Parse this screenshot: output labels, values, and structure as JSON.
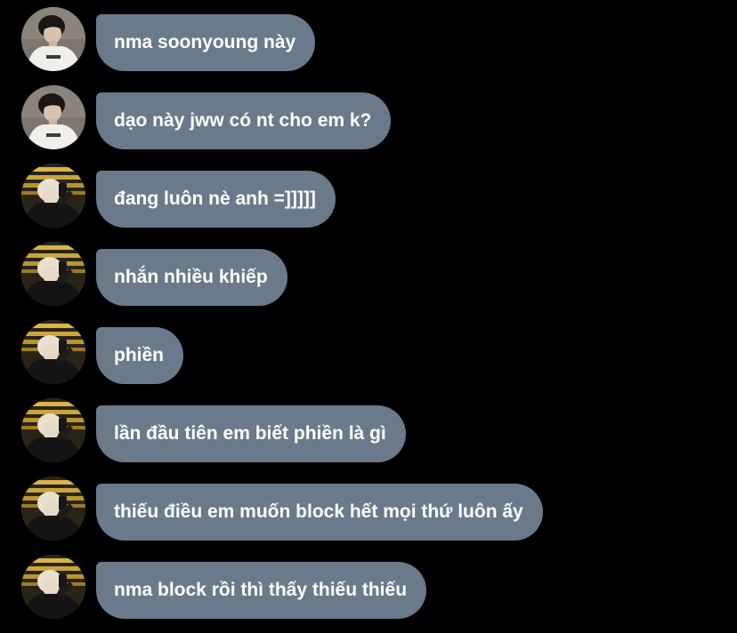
{
  "messages": [
    {
      "sender": "a",
      "text": "nma soonyoung này"
    },
    {
      "sender": "a",
      "text": "dạo này jww có nt cho em k?"
    },
    {
      "sender": "b",
      "text": "đang luôn nè anh =]]]]]"
    },
    {
      "sender": "b",
      "text": "nhắn nhiều khiếp"
    },
    {
      "sender": "b",
      "text": "phiền"
    },
    {
      "sender": "b",
      "text": "lần đầu tiên em biết phiền là gì"
    },
    {
      "sender": "b",
      "text": "thiếu điều em muốn block hết mọi thứ luôn ấy"
    },
    {
      "sender": "b",
      "text": "nma block rồi thì thấy thiếu thiếu"
    }
  ],
  "colors": {
    "background": "#000000",
    "bubble": "#6a7a8b",
    "bubble_text": "#ffffff"
  },
  "avatars": {
    "a": "avatar-photo-white-shirt",
    "b": "avatar-photo-dark-jacket-blonde"
  }
}
